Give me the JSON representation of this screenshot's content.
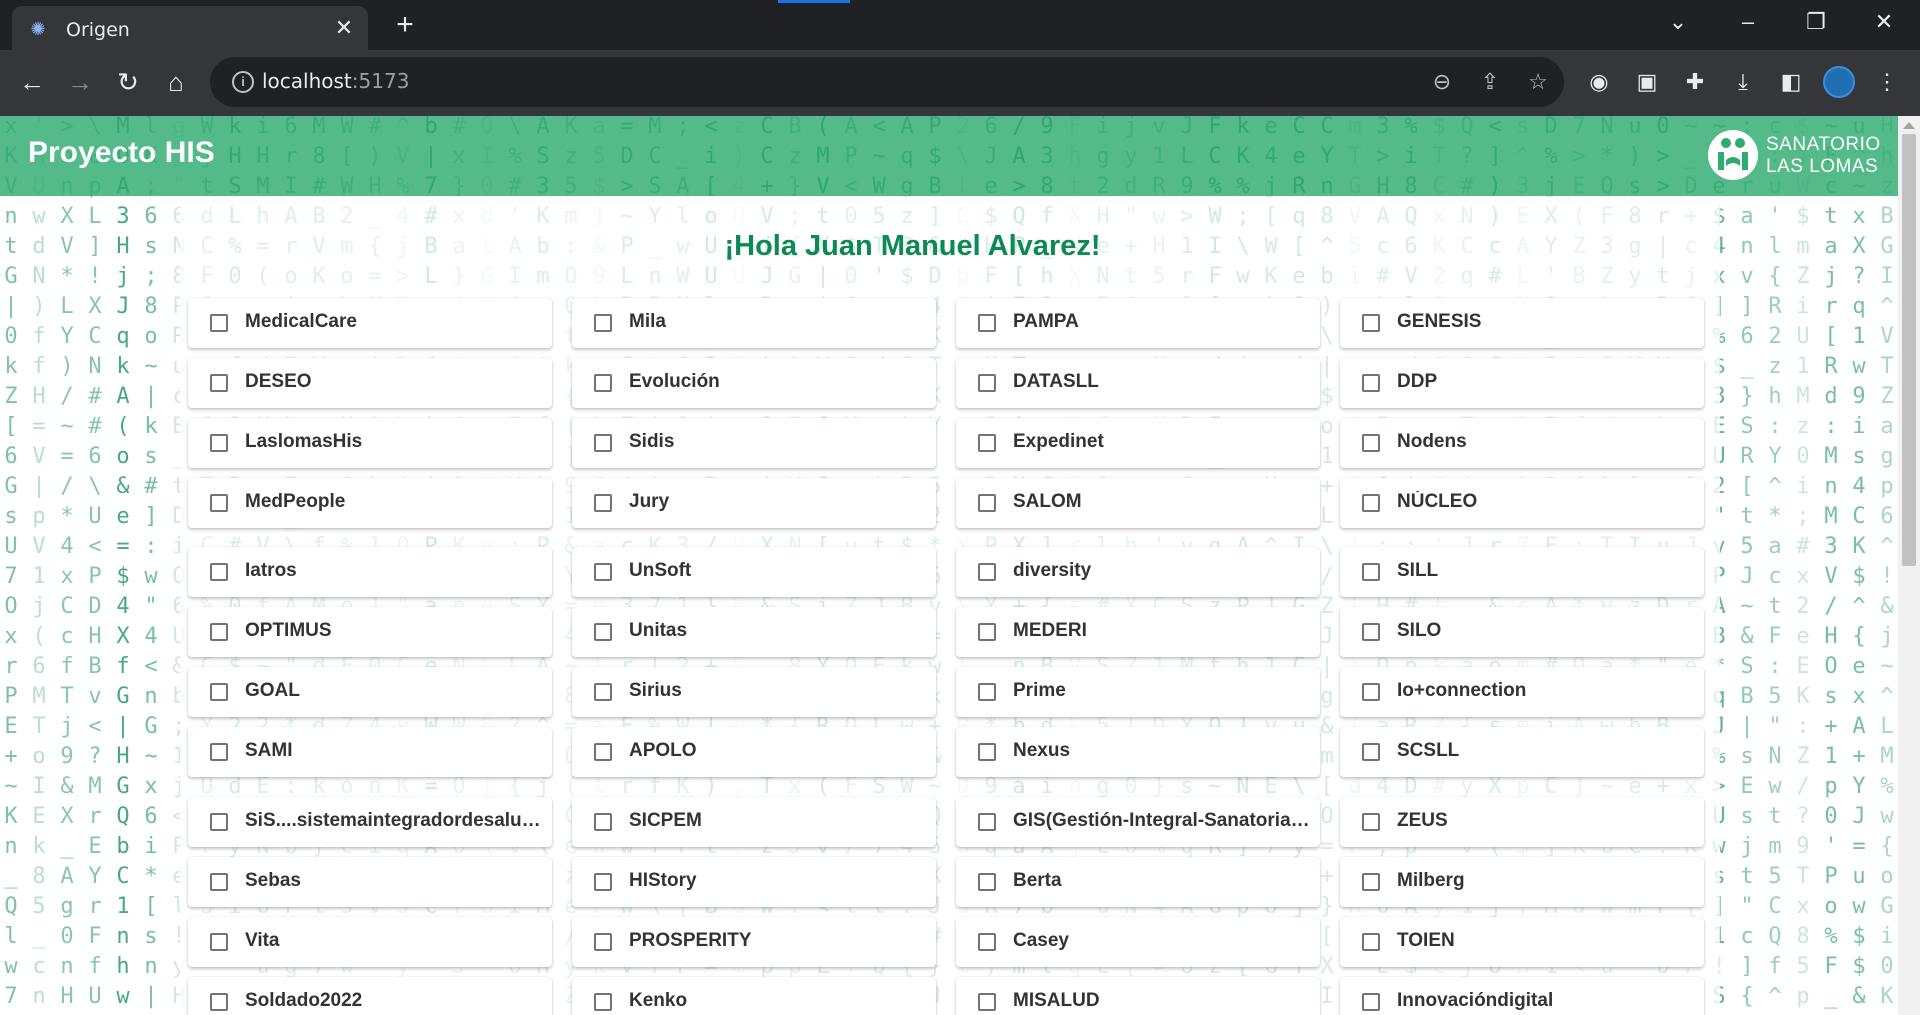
{
  "browser": {
    "tab_title": "Origen",
    "tab_close": "✕",
    "new_tab": "+",
    "url_host": "localhost",
    "url_port": ":5173"
  },
  "header": {
    "brand": "Proyecto HIS",
    "logo_line1": "SANATORIO",
    "logo_line2": "LAS LOMAS"
  },
  "greeting": "¡Hola Juan Manuel Alvarez!",
  "systems": [
    [
      "MedicalCare",
      "Mila",
      "PAMPA",
      "GENESIS"
    ],
    [
      "DESEO",
      "Evolución",
      "DATASLL",
      "DDP"
    ],
    [
      "LaslomasHis",
      "Sidis",
      "Expedinet",
      "Nodens"
    ],
    [
      "MedPeople",
      "Jury",
      "SALOM",
      "NÚCLEO"
    ],
    [
      "Iatros",
      "UnSoft",
      "diversity",
      "SILL"
    ],
    [
      "OPTIMUS",
      "Unitas",
      "MEDERI",
      "SILO"
    ],
    [
      "GOAL",
      "Sirius",
      "Prime",
      "Io+connection"
    ],
    [
      "SAMI",
      "APOLO",
      "Nexus",
      "SCSLL"
    ],
    [
      "SiS....sistemaintegradordesalud ...",
      "SICPEM",
      "GIS(Gestión-Integral-Sanatorial) ...",
      "ZEUS"
    ],
    [
      "Sebas",
      "HIStory",
      "Berta",
      "Milberg"
    ],
    [
      "Vita",
      "PROSPERITY",
      "Casey",
      "TOIEN"
    ],
    [
      "Soldado2022",
      "Kenko",
      "MISALUD",
      "Innovacióndigital"
    ]
  ],
  "colors": {
    "header_green": "#2eab6f",
    "greeting_green": "#0b8a53",
    "matrix_green": "#0a8a58"
  }
}
